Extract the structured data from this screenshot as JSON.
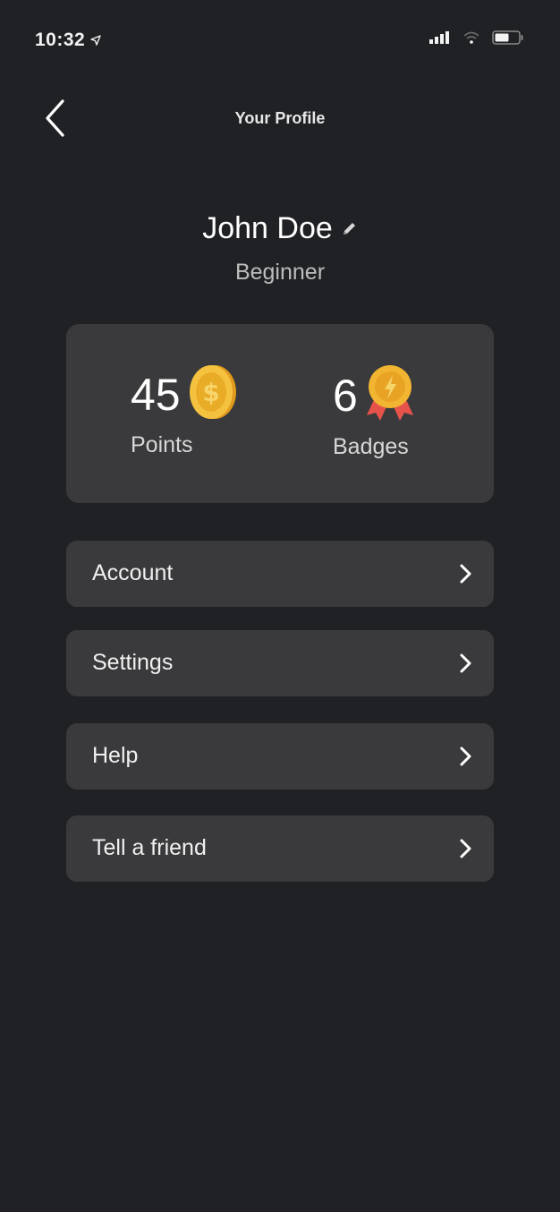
{
  "status_bar": {
    "time": "10:32",
    "icons": [
      "location-arrow-icon",
      "signal-icon",
      "wifi-icon",
      "battery-icon"
    ]
  },
  "header": {
    "title": "Your Profile",
    "back_icon": "chevron-left-icon"
  },
  "profile": {
    "name": "John Doe",
    "level": "Beginner",
    "edit_icon": "pencil-icon"
  },
  "stats": {
    "points": {
      "value": "45",
      "label": "Points",
      "icon": "coin-icon"
    },
    "badges": {
      "value": "6",
      "label": "Badges",
      "icon": "medal-icon"
    }
  },
  "menu": {
    "items": [
      {
        "label": "Account"
      },
      {
        "label": "Settings"
      },
      {
        "label": "Help"
      },
      {
        "label": "Tell a friend"
      }
    ]
  },
  "colors": {
    "background": "#202124",
    "card": "#3a3a3c",
    "coin": "#f2b531",
    "medal_ribbon": "#e5534b"
  }
}
